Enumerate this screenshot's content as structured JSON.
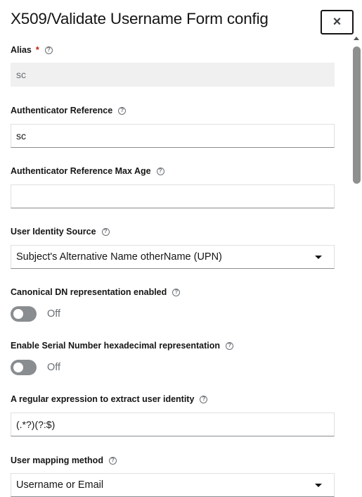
{
  "header": {
    "title": "X509/Validate Username Form config",
    "close_label": "×"
  },
  "fields": {
    "alias": {
      "label": "Alias",
      "required": "*",
      "value": "sc"
    },
    "auth_ref": {
      "label": "Authenticator Reference",
      "value": "sc"
    },
    "auth_ref_max_age": {
      "label": "Authenticator Reference Max Age",
      "value": ""
    },
    "user_identity_source": {
      "label": "User Identity Source",
      "value": "Subject's Alternative Name otherName (UPN)"
    },
    "canonical_dn": {
      "label": "Canonical DN representation enabled",
      "state": "Off"
    },
    "serial_hex": {
      "label": "Enable Serial Number hexadecimal representation",
      "state": "Off"
    },
    "regex": {
      "label": "A regular expression to extract user identity",
      "value": "(.*?)(?:$)"
    },
    "mapping_method": {
      "label": "User mapping method",
      "value": "Username or Email"
    }
  },
  "icons": {
    "help": "help-circle-icon",
    "help_glyph": "?"
  },
  "colors": {
    "required": "#c9190b",
    "switch_off": "#8a8d90",
    "disabled_bg": "#f0f0f0"
  }
}
